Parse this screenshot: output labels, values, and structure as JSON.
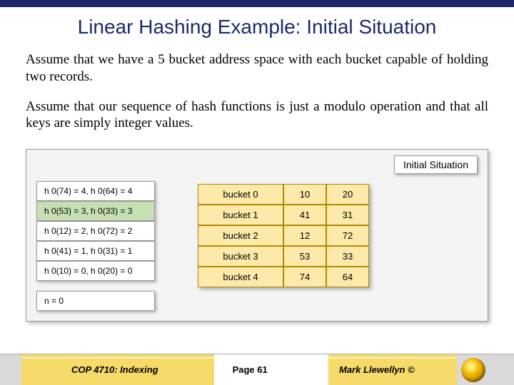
{
  "title": "Linear Hashing Example: Initial Situation",
  "paragraphs": [
    "Assume that we have a 5 bucket address space with each bucket capable of holding two records.",
    "Assume that our sequence of hash functions is just a modulo operation and that all keys are simply integer values."
  ],
  "diagram": {
    "caption": "Initial Situation",
    "hashes": [
      {
        "text": "h 0(74) = 4, h 0(64) = 4",
        "hl": false
      },
      {
        "text": "h 0(53) = 3, h 0(33) = 3",
        "hl": true
      },
      {
        "text": "h 0(12) = 2, h 0(72) = 2",
        "hl": false
      },
      {
        "text": "h 0(41) = 1, h 0(31) = 1",
        "hl": false
      },
      {
        "text": "h 0(10) = 0, h 0(20) = 0",
        "hl": false
      }
    ],
    "n_label": "n = 0",
    "buckets": [
      {
        "label": "bucket 0",
        "v1": "10",
        "v2": "20"
      },
      {
        "label": "bucket 1",
        "v1": "41",
        "v2": "31"
      },
      {
        "label": "bucket 2",
        "v1": "12",
        "v2": "72"
      },
      {
        "label": "bucket 3",
        "v1": "53",
        "v2": "33"
      },
      {
        "label": "bucket 4",
        "v1": "74",
        "v2": "64"
      }
    ]
  },
  "footer": {
    "left": "COP 4710: Indexing",
    "mid": "Page 61",
    "right": "Mark Llewellyn ©"
  }
}
